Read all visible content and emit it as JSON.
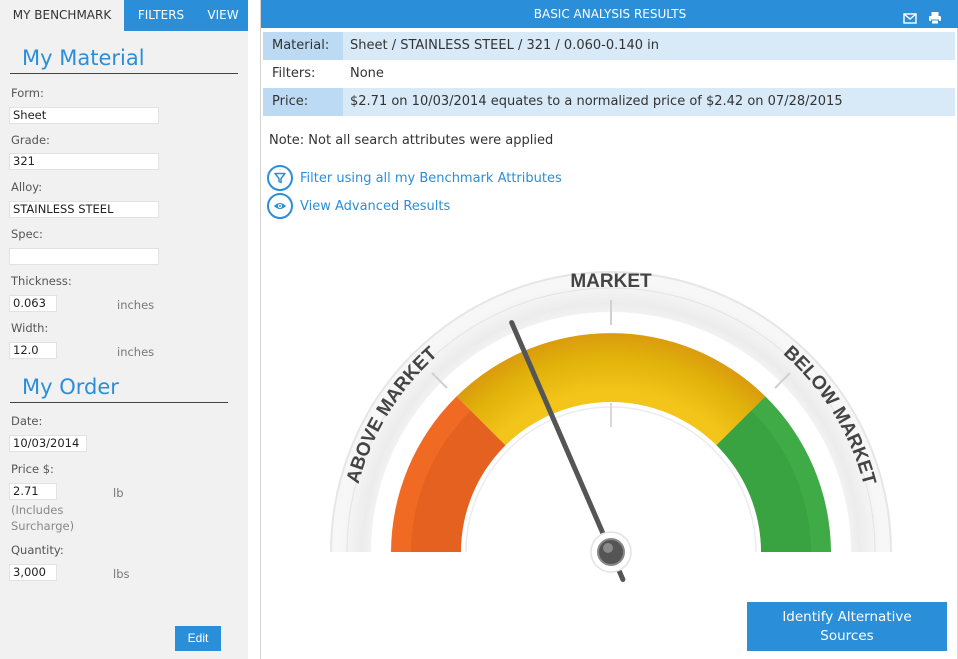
{
  "tabs": [
    {
      "label": "MY BENCHMARK"
    },
    {
      "label": "FILTERS"
    },
    {
      "label": "VIEW"
    }
  ],
  "material": {
    "title": "My Material",
    "form_label": "Form:",
    "form_value": "Sheet",
    "grade_label": "Grade:",
    "grade_value": "321",
    "alloy_label": "Alloy:",
    "alloy_value": "STAINLESS STEEL",
    "spec_label": "Spec:",
    "spec_value": "",
    "thickness_label": "Thickness:",
    "thickness_value": "0.063",
    "thickness_unit": "inches",
    "width_label": "Width:",
    "width_value": "12.0",
    "width_unit": "inches"
  },
  "order": {
    "title": "My Order",
    "date_label": "Date:",
    "date_value": "10/03/2014",
    "price_label": "Price $:",
    "price_value": "2.71",
    "price_unit": "lb",
    "price_note_1": "(Includes",
    "price_note_2": "Surcharge)",
    "quantity_label": "Quantity:",
    "quantity_value": "3,000",
    "quantity_unit": "lbs",
    "edit_label": "Edit"
  },
  "results": {
    "header_title": "BASIC ANALYSIS RESULTS",
    "email_icon": "envelope-icon",
    "print_icon": "printer-icon",
    "material_key": "Material:",
    "material_value": "Sheet / STAINLESS STEEL / 321 / 0.060-0.140 in",
    "filters_key": "Filters:",
    "filters_value": "None",
    "price_key": "Price:",
    "price_value": "$2.71 on 10/03/2014 equates to a normalized price of $2.42 on 07/28/2015",
    "note": "Note: Not all search attributes were applied",
    "filter_link": "Filter using all my Benchmark Attributes",
    "advanced_link": "View Advanced Results",
    "gauge_market": "MARKET",
    "gauge_above": "ABOVE MARKET",
    "gauge_below": "BELOW MARKET",
    "gauge_needle_position": 0.37,
    "alt_button_line1": "Identify Alternative",
    "alt_button_line2": "Sources"
  },
  "colors": {
    "accent": "#2a8fd8",
    "above_market": "#f06a23",
    "market": "#e5b90b",
    "below_market": "#3fab47"
  }
}
